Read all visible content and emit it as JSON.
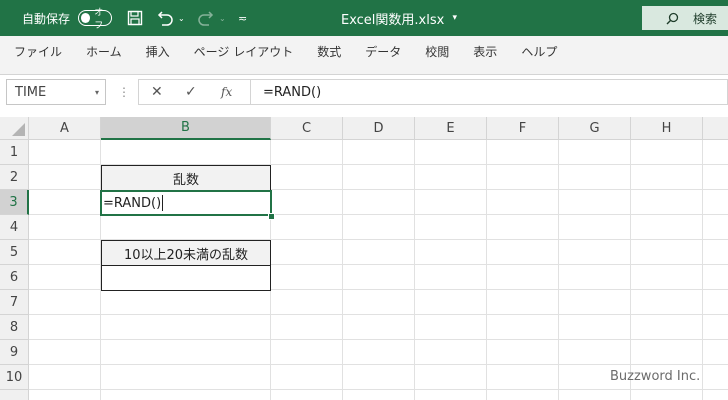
{
  "titlebar": {
    "autosave_label": "自動保存",
    "autosave_state": "オフ",
    "file_name": "Excel関数用.xlsx",
    "file_name_arrow": "▾",
    "undo_arrow": "⌄",
    "redo_arrow": "⌄",
    "qat_more": "≂",
    "search_label": "検索",
    "accent_color": "#217346"
  },
  "menu": [
    "ファイル",
    "ホーム",
    "挿入",
    "ページ レイアウト",
    "数式",
    "データ",
    "校閲",
    "表示",
    "ヘルプ"
  ],
  "formula_bar": {
    "name_box": "TIME",
    "name_box_arrow": "▾",
    "dots": "⋮",
    "cancel_symbol": "✕",
    "enter_symbol": "✓",
    "fx_symbol": "fx",
    "formula": "=RAND()"
  },
  "sheet": {
    "columns": [
      "A",
      "B",
      "C",
      "D",
      "E",
      "F",
      "G",
      "H"
    ],
    "selected_column": "B",
    "rows": [
      "1",
      "2",
      "3",
      "4",
      "5",
      "6",
      "7",
      "8",
      "9",
      "10"
    ],
    "selected_row": "3",
    "cells": {
      "B2": "乱数",
      "B3": "=RAND()",
      "B5": "10以上20未満の乱数",
      "B6": ""
    }
  },
  "watermark": "Buzzword Inc."
}
